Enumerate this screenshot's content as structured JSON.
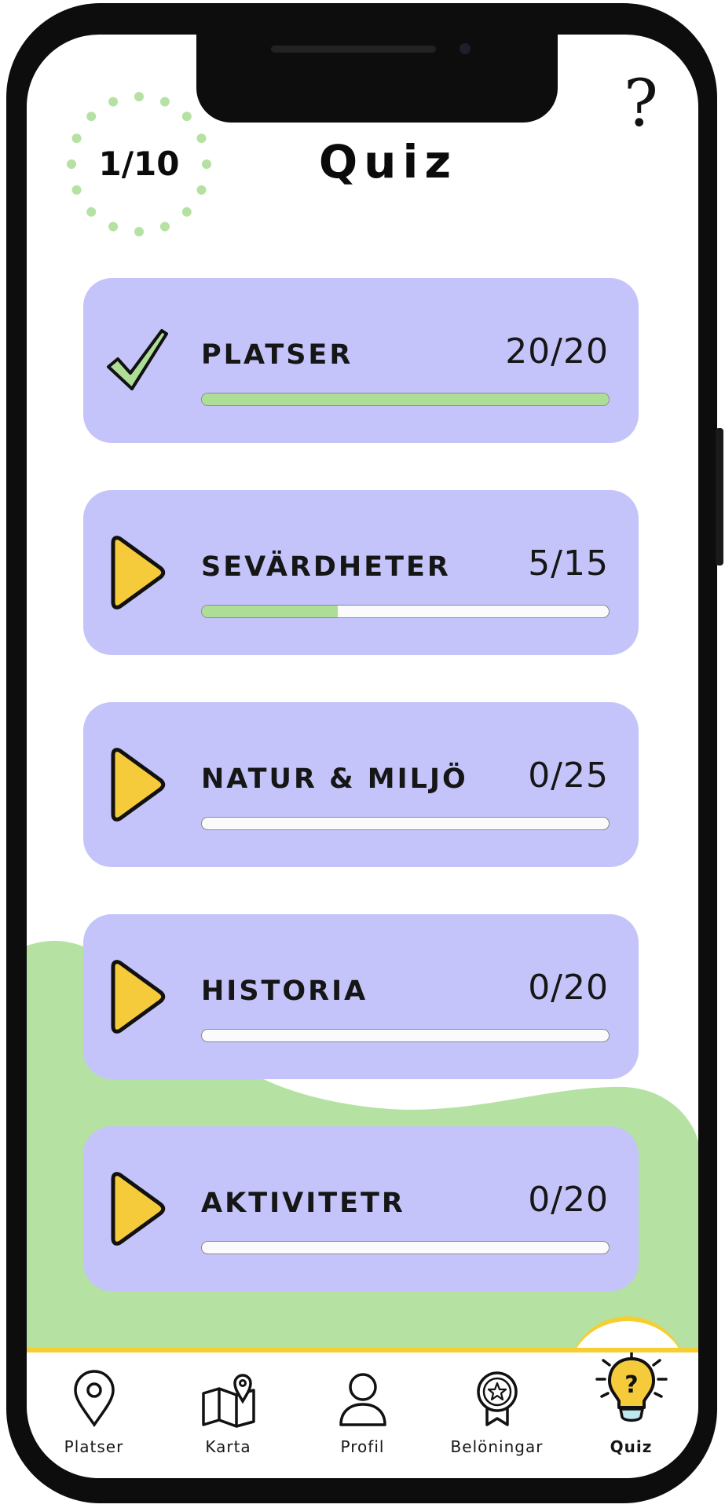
{
  "header": {
    "progress_badge": "1/10",
    "title": "Quiz",
    "help_label": "?"
  },
  "categories": [
    {
      "label": "PLATSER",
      "score": "20/20",
      "progress": 1.0,
      "status_icon": "check-icon"
    },
    {
      "label": "SEVÄRDHETER",
      "score": "5/15",
      "progress": 0.3333,
      "status_icon": "play-icon"
    },
    {
      "label": "NATUR & MILJÖ",
      "score": "0/25",
      "progress": 0.0,
      "status_icon": "play-icon"
    },
    {
      "label": "HISTORIA",
      "score": "0/20",
      "progress": 0.0,
      "status_icon": "play-icon"
    },
    {
      "label": "AKTIVITETR",
      "score": "0/20",
      "progress": 0.0,
      "status_icon": "play-icon"
    }
  ],
  "nav": {
    "items": [
      {
        "label": "Platser",
        "icon": "map-pin-icon"
      },
      {
        "label": "Karta",
        "icon": "map-icon"
      },
      {
        "label": "Profil",
        "icon": "user-icon"
      },
      {
        "label": "Belöningar",
        "icon": "award-icon"
      },
      {
        "label": "Quiz",
        "icon": "lightbulb-question-icon",
        "active": true
      }
    ]
  },
  "colors": {
    "card": "#c4c4fa",
    "progress_fill": "#aedd97",
    "accent": "#f5cf31",
    "hill": "#b5e1a2",
    "badge_dots": "#b5e1a2"
  }
}
